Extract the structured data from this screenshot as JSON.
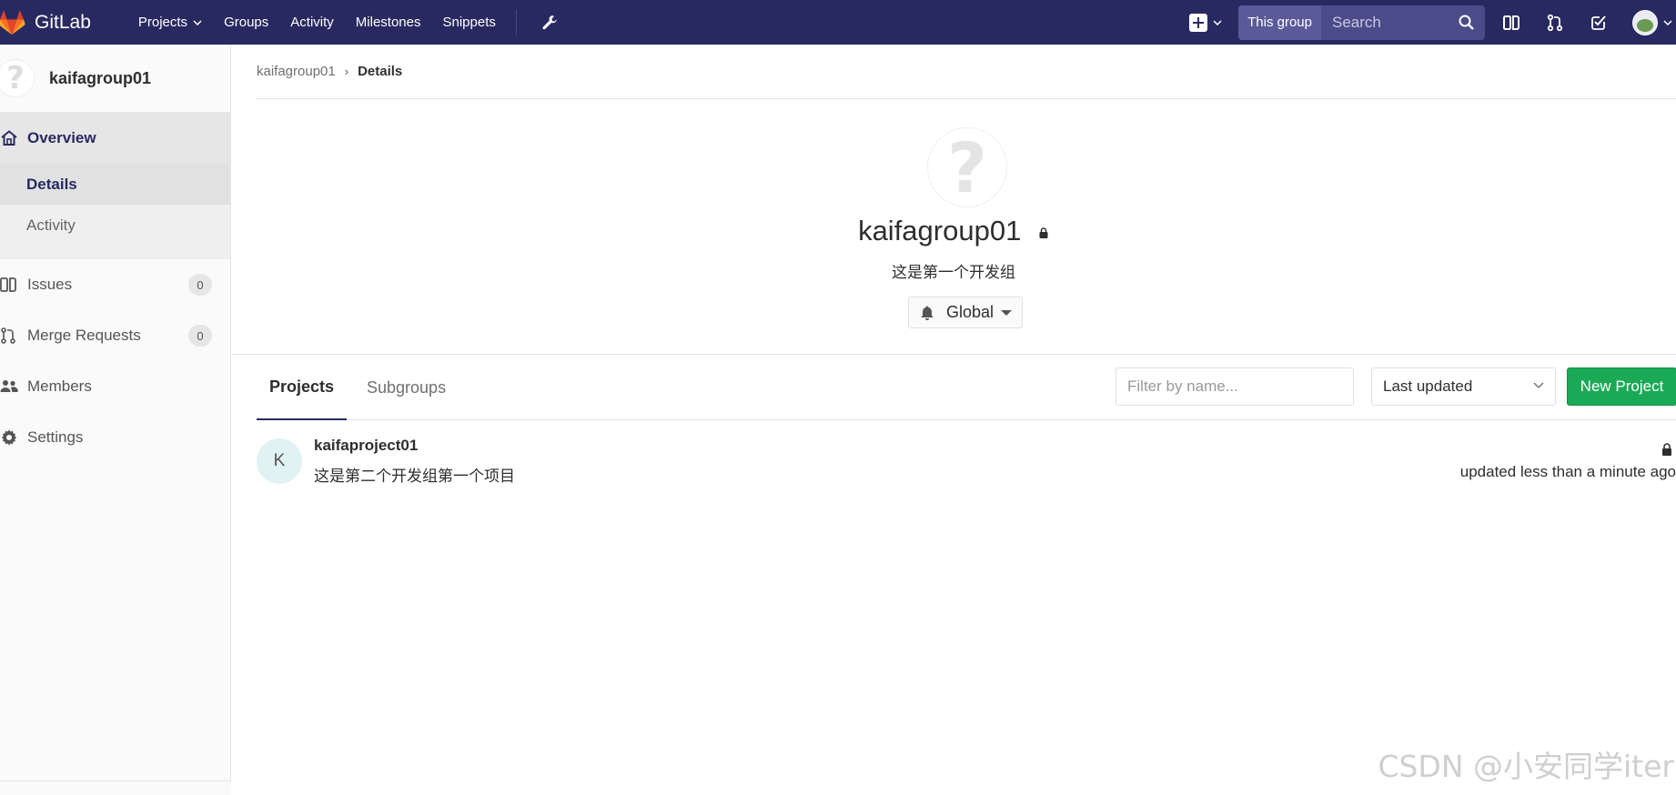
{
  "navbar": {
    "brand": "GitLab",
    "links": [
      {
        "label": "Projects",
        "dropdown": true
      },
      {
        "label": "Groups"
      },
      {
        "label": "Activity"
      },
      {
        "label": "Milestones"
      },
      {
        "label": "Snippets"
      }
    ],
    "search_scope": "This group",
    "search_placeholder": "Search"
  },
  "sidebar": {
    "group_name": "kaifagroup01",
    "overview_label": "Overview",
    "overview_children": [
      "Details",
      "Activity"
    ],
    "items": [
      {
        "label": "Issues",
        "count": "0"
      },
      {
        "label": "Merge Requests",
        "count": "0"
      },
      {
        "label": "Members"
      },
      {
        "label": "Settings"
      }
    ]
  },
  "breadcrumb": {
    "parent": "kaifagroup01",
    "current": "Details"
  },
  "group": {
    "name": "kaifagroup01",
    "description": "这是第一个开发组",
    "notification_level": "Global"
  },
  "tabs": {
    "projects": "Projects",
    "subgroups": "Subgroups"
  },
  "toolbar": {
    "filter_placeholder": "Filter by name...",
    "sort_value": "Last updated",
    "new_project": "New Project"
  },
  "projects": [
    {
      "initial": "K",
      "name": "kaifaproject01",
      "description": "这是第二个开发组第一个项目",
      "updated": "updated less than a minute ago"
    }
  ],
  "watermark": "CSDN @小安同学iter",
  "colors": {
    "navbar": "#292961",
    "accent": "#292961",
    "primary_button": "#1aaa55"
  }
}
